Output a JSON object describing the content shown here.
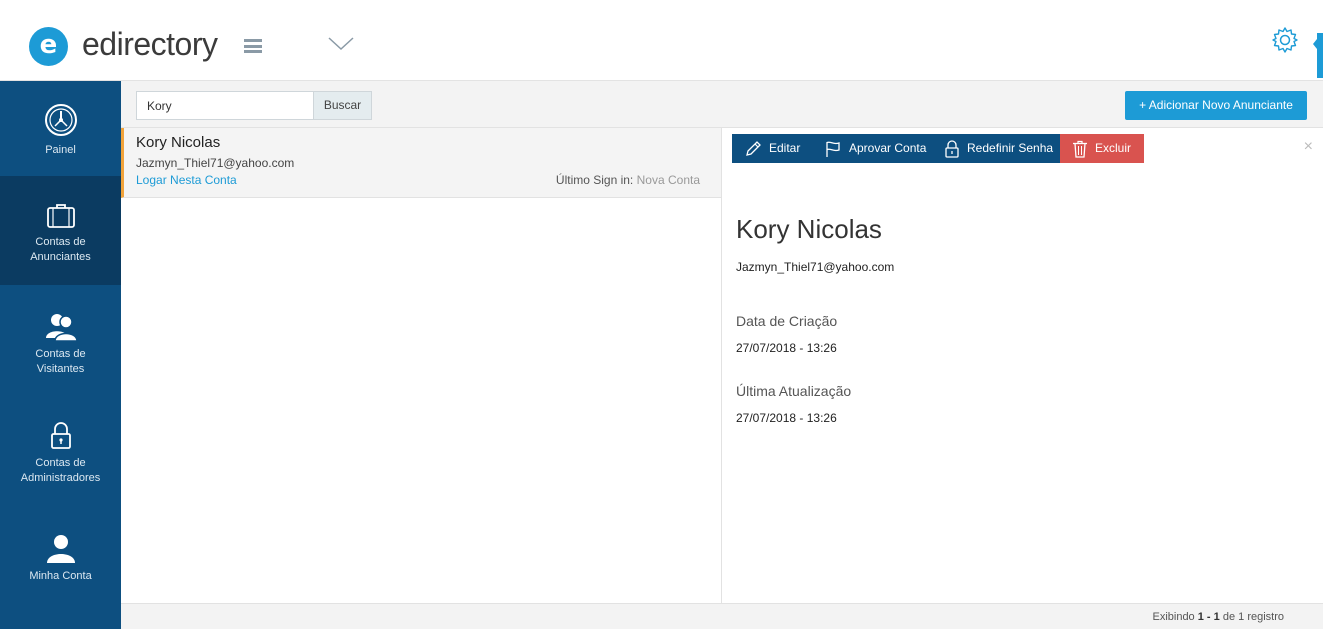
{
  "header": {
    "logo_letter": "e",
    "logo_text": "edirectory",
    "colors": {
      "brand": "#1d9bd6",
      "sidebar": "#0d4f80",
      "danger": "#d9534f",
      "accent": "#f1a33b"
    }
  },
  "sidebar": {
    "items": [
      {
        "label": "Painel",
        "icon": "dashboard-icon"
      },
      {
        "label_line1": "Contas de",
        "label_line2": "Anunciantes",
        "icon": "briefcase-icon",
        "active": true
      },
      {
        "label_line1": "Contas de",
        "label_line2": "Visitantes",
        "icon": "users-icon"
      },
      {
        "label_line1": "Contas de",
        "label_line2": "Administradores",
        "icon": "lock-icon"
      },
      {
        "label": "Minha Conta",
        "icon": "user-icon"
      }
    ]
  },
  "search": {
    "value": "Kory",
    "button_label": "Buscar"
  },
  "add_button_label": "+ Adicionar Novo Anunciante",
  "list": {
    "items": [
      {
        "name": "Kory Nicolas",
        "email": "Jazmyn_Thiel71@yahoo.com",
        "login_link": "Logar Nesta Conta",
        "last_signin_label": "Último Sign in:",
        "last_signin_value": "Nova Conta"
      }
    ]
  },
  "detail": {
    "actions": {
      "edit": "Editar",
      "approve": "Aprovar Conta",
      "reset": "Redefinir Senha",
      "delete": "Excluir"
    },
    "close": "×",
    "name": "Kory Nicolas",
    "email": "Jazmyn_Thiel71@yahoo.com",
    "created_label": "Data de Criação",
    "created_value": "27/07/2018 - 13:26",
    "updated_label": "Última Atualização",
    "updated_value": "27/07/2018 - 13:26"
  },
  "footer": {
    "prefix": "Exibindo",
    "range": "1 - 1",
    "middle": "de",
    "total_text": "1 registro"
  }
}
